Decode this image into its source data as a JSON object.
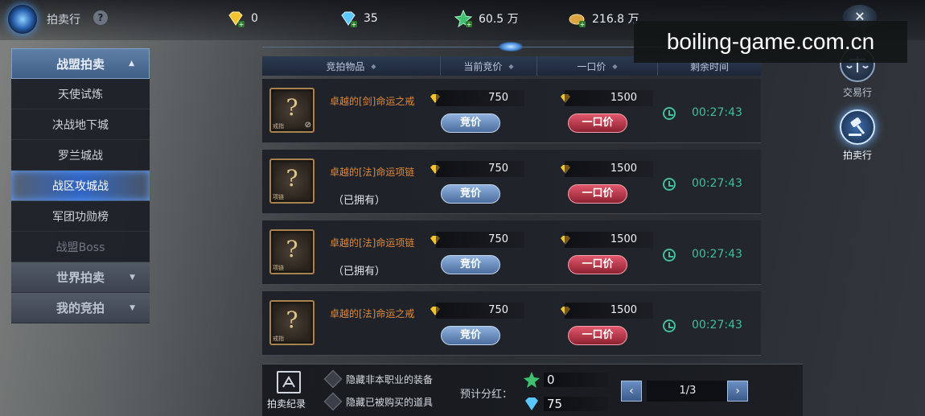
{
  "app": {
    "title": "拍卖行",
    "help_symbol": "?",
    "close_symbol": "✕"
  },
  "resources": [
    {
      "name": "gold-diamond",
      "value": "0",
      "color": "#f4c430"
    },
    {
      "name": "blue-diamond",
      "value": "35",
      "color": "#5ac8ff"
    },
    {
      "name": "green-crystal",
      "value": "60.5 万",
      "color": "#3fbf6f"
    },
    {
      "name": "gold-ingot",
      "value": "216.8 万",
      "color": "#d9a441"
    }
  ],
  "watermark": "boiling-game.com.cn",
  "sidebar": {
    "header": "战盟拍卖",
    "items": [
      "天使试炼",
      "决战地下城",
      "罗兰城战",
      "战区攻城战",
      "军团功勋榜",
      "战盟Boss"
    ],
    "active_index": 3,
    "groups": [
      "世界拍卖",
      "我的竞拍"
    ]
  },
  "table": {
    "columns": [
      "竞拍物品",
      "当前竞价",
      "一口价",
      "剩余时间"
    ],
    "rows": [
      {
        "name": "卓越的[剑]命运之戒",
        "owned": "",
        "bid": "750",
        "buyout": "1500",
        "time": "00:27:43",
        "tag": "戒指",
        "restricted": true
      },
      {
        "name": "卓越的[法]命运项链",
        "owned": "（已拥有）",
        "bid": "750",
        "buyout": "1500",
        "time": "00:27:43",
        "tag": "项链",
        "restricted": false
      },
      {
        "name": "卓越的[法]命运项链",
        "owned": "（已拥有）",
        "bid": "750",
        "buyout": "1500",
        "time": "00:27:43",
        "tag": "项链",
        "restricted": false
      },
      {
        "name": "卓越的[法]命运之戒",
        "owned": "",
        "bid": "750",
        "buyout": "1500",
        "time": "00:27:43",
        "tag": "戒指",
        "restricted": false
      }
    ],
    "bid_label": "竞价",
    "buyout_label": "一口价"
  },
  "right_nav": [
    {
      "label": "交易行",
      "active": false
    },
    {
      "label": "拍卖行",
      "active": true
    }
  ],
  "bottom": {
    "record_label": "拍卖纪录",
    "filter1": "隐藏非本职业的装备",
    "filter2": "隐藏已被购买的道具",
    "estimate_label": "预计分红：",
    "bonus_green": "0",
    "bonus_blue": "75",
    "page": "1/3",
    "prev_symbol": "‹",
    "next_symbol": "›"
  }
}
